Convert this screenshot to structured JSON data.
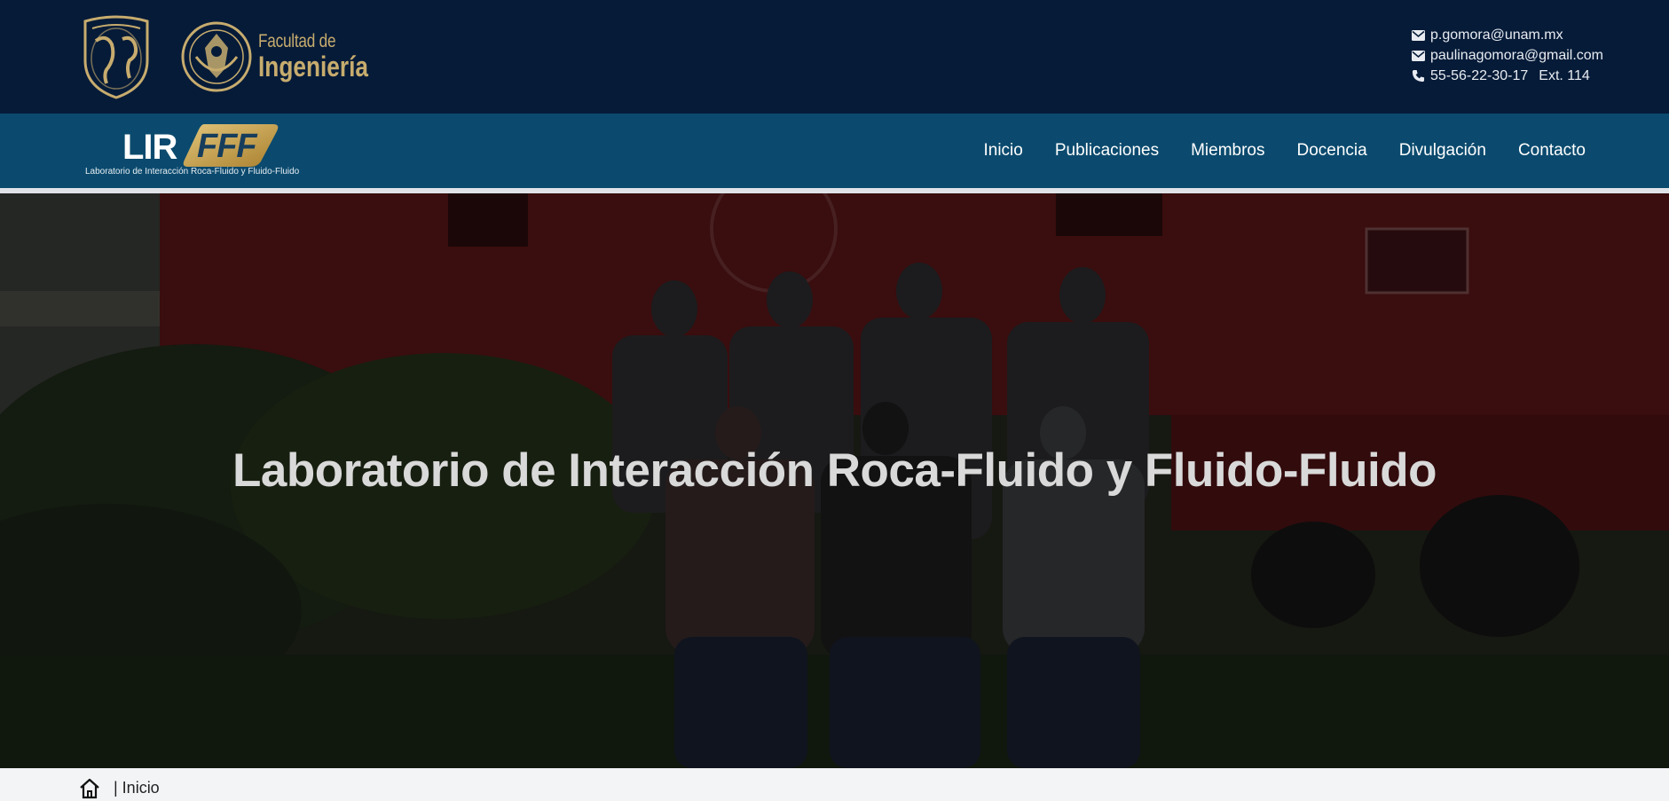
{
  "header": {
    "faculty_line1": "Facultad de",
    "faculty_line2": "Ingeniería",
    "contact": {
      "email1": "p.gomora@unam.mx",
      "email2": "paulinagomora@gmail.com",
      "phone": "55-56-22-30-17",
      "ext": "Ext. 114"
    }
  },
  "brand": {
    "lir": "LIR",
    "fff": "FFF",
    "subtitle": "Laboratorio de Interacción Roca-Fluido y Fluido-Fluido"
  },
  "nav": {
    "items": [
      "Inicio",
      "Publicaciones",
      "Miembros",
      "Docencia",
      "Divulgación",
      "Contacto"
    ]
  },
  "hero": {
    "title": "Laboratorio de Interacción Roca-Fluido y Fluido-Fluido"
  },
  "breadcrumb": {
    "current": "| Inicio"
  },
  "colors": {
    "header_bg": "#061b38",
    "nav_bg": "#0b4a6e",
    "gold": "#c7ac6e",
    "brand_badge": "#c9a24e"
  },
  "icons": [
    "unam-seal",
    "fi-seal",
    "envelope-icon",
    "phone-icon",
    "home-icon"
  ]
}
